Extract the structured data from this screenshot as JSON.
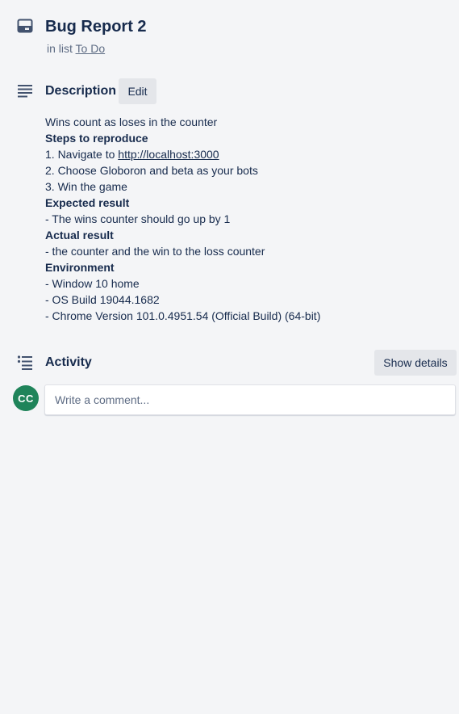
{
  "card": {
    "title": "Bug Report 2",
    "list_prefix": "in list",
    "list_name": "To Do",
    "icon": "card-icon"
  },
  "description": {
    "heading": "Description",
    "edit_label": "Edit",
    "icon": "description-icon",
    "lines": [
      "Wins count as loses in the counter",
      "Steps to reproduce",
      "1. Navigate to ",
      "http://localhost:3000",
      "2. Choose Globoron and beta as your bots",
      "3. Win the game",
      "Expected result",
      "- The wins counter should go up by 1",
      "Actual result",
      "- the counter and the win to the loss counter",
      "Environment",
      "- Window 10 home",
      "- OS Build 19044.1682",
      "- Chrome Version 101.0.4951.54 (Official Build) (64-bit)"
    ]
  },
  "activity": {
    "heading": "Activity",
    "show_details_label": "Show details",
    "icon": "activity-icon"
  },
  "comment": {
    "avatar_initials": "CC",
    "placeholder": "Write a comment..."
  },
  "colors": {
    "background": "#f4f5f7",
    "text": "#172b4d",
    "muted": "#5e6c84",
    "button": "#e4e6ea",
    "avatar": "#1f845a"
  }
}
